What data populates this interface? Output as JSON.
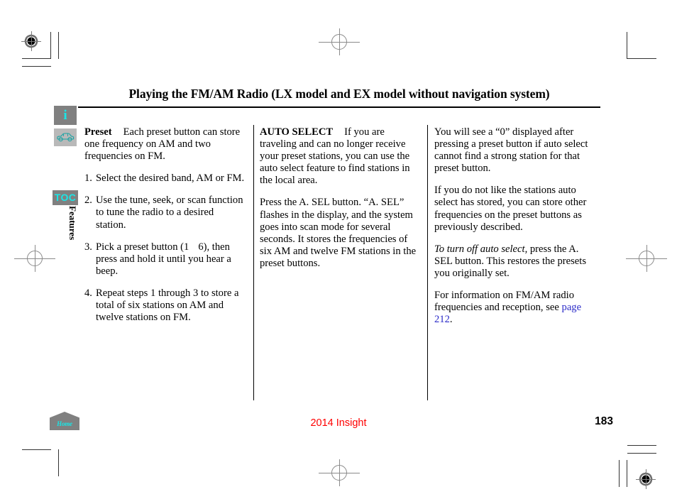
{
  "document": {
    "title": "Playing the FM/AM Radio (LX model and EX model without navigation system)"
  },
  "sidebar": {
    "info_icon_label": "i",
    "car_icon_name": "car-icon",
    "toc_label": "TOC",
    "section_label": "Features"
  },
  "columns": {
    "left": {
      "lead": "Preset",
      "lead_body": "Each preset button can store one frequency on AM and two frequencies on FM.",
      "steps": [
        {
          "num": "1.",
          "text_a": "Select the desired band, AM or FM.",
          "text_b": ""
        },
        {
          "num": "2.",
          "text_a": "Use the tune, seek, or scan function to tune the radio to a desired station.",
          "text_b": ""
        },
        {
          "num": "3.",
          "text_a": "Pick a preset button (1",
          "text_b": "6), then press and hold it until you hear a beep."
        },
        {
          "num": "4.",
          "text_a": "Repeat steps 1 through 3 to store a total of six stations on AM and twelve stations on FM.",
          "text_b": ""
        }
      ]
    },
    "middle": {
      "lead": "AUTO SELECT",
      "lead_body": "If you are traveling and can no longer receive your preset stations, you can use the auto select feature to find stations in the local area.",
      "paragraph_2": "Press the A. SEL button. “A. SEL” flashes in the display, and the system goes into scan mode for several seconds. It stores the frequencies of six AM and twelve FM stations in the preset buttons."
    },
    "right": {
      "paragraph_1": "You will see a “0” displayed after pressing a preset button if auto select cannot find a strong station for that preset button.",
      "paragraph_2": "If you do not like the stations auto select has stored, you can store other frequencies on the preset buttons as previously described.",
      "paragraph_3_italic": "To turn off auto select,",
      "paragraph_3_rest": "press the A. SEL button. This restores the presets you originally set.",
      "paragraph_4_before": "For information on FM/AM radio frequencies and reception, see",
      "paragraph_4_link": "page 212",
      "paragraph_4_after": "."
    }
  },
  "footer": {
    "home_label": "Home",
    "model_year": "2014 Insight",
    "page_number": "183"
  },
  "colors": {
    "accent_cyan": "#19e6e6",
    "tab_gray": "#808080",
    "link_blue": "#2b2bc8",
    "footer_red": "#ff0000"
  }
}
